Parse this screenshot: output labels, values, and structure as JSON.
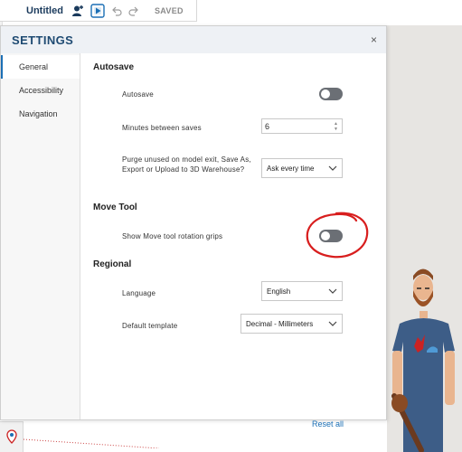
{
  "toolbar": {
    "title": "Untitled",
    "saved_label": "SAVED",
    "icons": [
      "add-user-icon",
      "play-icon",
      "undo-icon",
      "redo-icon"
    ]
  },
  "dialog": {
    "title": "SETTINGS",
    "close_label": "×"
  },
  "sidebar": {
    "items": [
      {
        "label": "General",
        "active": true
      },
      {
        "label": "Accessibility",
        "active": false
      },
      {
        "label": "Navigation",
        "active": false
      }
    ]
  },
  "autosave": {
    "section_title": "Autosave",
    "toggle_label": "Autosave",
    "toggle_on": false,
    "minutes_label": "Minutes between saves",
    "minutes_value": "6",
    "purge_label": "Purge unused on model exit, Save As, Export or Upload to 3D Warehouse?",
    "purge_value": "Ask every time"
  },
  "move_tool": {
    "section_title": "Move Tool",
    "grips_label": "Show Move tool rotation grips",
    "grips_on": false
  },
  "regional": {
    "section_title": "Regional",
    "language_label": "Language",
    "language_value": "English",
    "template_label": "Default template",
    "template_value": "Decimal - Millimeters"
  },
  "footer": {
    "reset_label": "Reset all"
  },
  "colors": {
    "accent": "#1b6fb5",
    "title": "#1e4a72",
    "toggle_off": "#6b6f75",
    "annotation": "#d81e1e"
  }
}
